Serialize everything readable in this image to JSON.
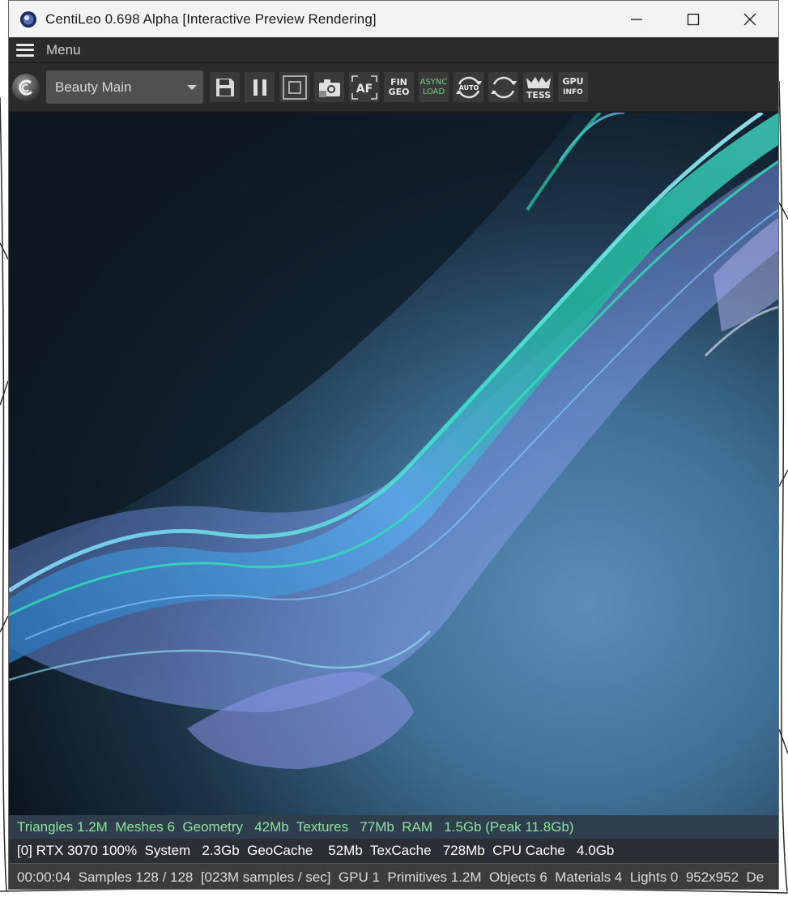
{
  "window": {
    "title": "CentiLeo 0.698 Alpha  [Interactive Preview Rendering]"
  },
  "menubar": {
    "menu_label": "Menu"
  },
  "toolbar": {
    "render_pass_select": "Beauty Main",
    "fin_geo": [
      "FIN",
      "GEO"
    ],
    "async_load": [
      "ASYNC",
      "LOAD"
    ],
    "auto_label": "AUTO",
    "tess_label": "TESS",
    "gpu_info": [
      "GPU",
      "INFO"
    ]
  },
  "status": {
    "line1": "Triangles 1.2M  Meshes 6  Geometry   42Mb  Textures   77Mb  RAM   1.5Gb (Peak 11.8Gb)",
    "line2": "[0] RTX 3070 100%  System   2.3Gb  GeoCache    52Mb  TexCache   728Mb  CPU Cache   4.0Gb",
    "line3": "00:00:04  Samples 128 / 128  [023M samples / sec]  GPU 1  Primitives 1.2M  Objects 6  Materials 4  Lights 0  952x952  De"
  },
  "colors": {
    "status_green": "#8fe0a0",
    "titlebar_bg": "#f3f3f3",
    "toolbar_bg": "#2b2b2b"
  }
}
